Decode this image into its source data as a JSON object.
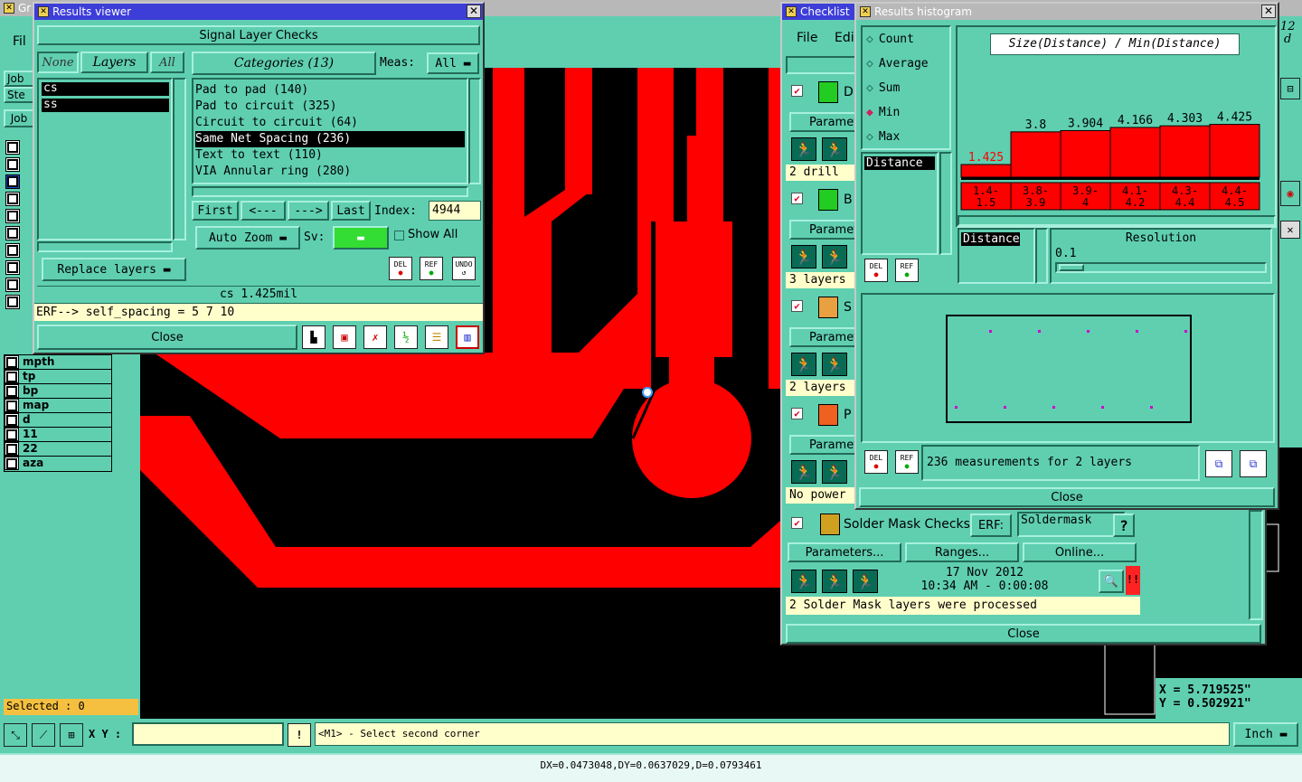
{
  "results_viewer": {
    "title": "Results viewer",
    "header": "Signal Layer Checks",
    "none_btn": "None",
    "layers_btn": "Layers",
    "all_btn": "All",
    "categories_btn": "Categories (13)",
    "meas_label": "Meas:",
    "meas_value": "All",
    "layers": [
      "cs",
      "ss"
    ],
    "categories": [
      "Pad to pad (140)",
      "Pad to circuit (325)",
      "Circuit to circuit (64)",
      "Same Net Spacing (236)",
      "Text to text (110)",
      "VIA Annular ring (280)"
    ],
    "selected_category": 3,
    "nav": {
      "first": "First",
      "prev": "<---",
      "next": "--->",
      "last": "Last",
      "index_label": "Index:",
      "index_value": "4944"
    },
    "auto_zoom": "Auto Zoom",
    "sv_label": "Sv:",
    "show_all": "Show All",
    "replace_layers": "Replace layers",
    "del": "DEL",
    "ref": "REF",
    "undo": "UNDO",
    "status": "cs 1.425mil",
    "erf_line": "ERF--> self_spacing = 5 7 10",
    "close": "Close"
  },
  "main": {
    "menu_file": "Fil",
    "left_rows": [
      "Job",
      "Ste",
      "Job"
    ],
    "layer_names": [
      "mpth",
      "tp",
      "bp",
      "map",
      "d",
      "11",
      "22",
      "aza"
    ],
    "selected": "Selected : 0",
    "xy_label": "X Y :",
    "prompt": "<M1> - Select second corner",
    "units": "Inch",
    "status_bar": "DX=0.0473048,DY=0.0637029,D=0.0793461",
    "coord_x": "X = 5.719525\"",
    "coord_y": "Y = 0.502921\"",
    "corner_text": "12",
    "corner_text2": "d"
  },
  "checklist": {
    "title": "Checklist",
    "menu": [
      "File",
      "Edi"
    ],
    "items": [
      {
        "name": "D",
        "params": "Paramet",
        "status": "2 drill"
      },
      {
        "name": "B",
        "params": "Paramet",
        "status": "3 layers"
      },
      {
        "name": "S",
        "params": "Paramet",
        "status": "2 layers"
      },
      {
        "name": "P",
        "params": "Paramet",
        "status": "No power"
      }
    ],
    "solder": {
      "name": "Solder Mask Checks",
      "erf_label": "ERF:",
      "erf_value": "Soldermask",
      "question": "?",
      "parameters": "Parameters...",
      "ranges": "Ranges...",
      "online": "Online...",
      "date": "17 Nov 2012",
      "time": "10:34 AM - 0:00:08",
      "status": "2 Solder Mask layers were processed",
      "alert": "!!"
    },
    "close": "Close"
  },
  "histogram": {
    "title": "Results histogram",
    "modes": [
      "Count",
      "Average",
      "Sum",
      "Min",
      "Max"
    ],
    "selected_mode": 3,
    "formula": "Size(Distance) / Min(Distance)",
    "list_item": "Distance",
    "resolution_field": "Distance",
    "resolution_label": "Resolution",
    "resolution_value": "0.1",
    "summary": "236 measurements for 2 layers",
    "del": "DEL",
    "ref": "REF",
    "close": "Close",
    "chart_data": {
      "type": "bar",
      "categories": [
        "1.4-\n1.5",
        "3.8-\n3.9",
        "3.9-\n4",
        "4.1-\n4.2",
        "4.3-\n4.4",
        "4.4-\n4.5"
      ],
      "values": [
        1.425,
        3.8,
        3.904,
        4.166,
        4.303,
        4.425
      ],
      "value_labels": [
        "1.425",
        "3.8",
        "3.904",
        "4.166",
        "4.303",
        "4.425"
      ],
      "bar_color": "#ff0000",
      "first_label_color": "#ff0000",
      "ylim": [
        0,
        5
      ]
    }
  },
  "colors": {
    "teal": "#5fcfb0",
    "trace": "#ff0000",
    "title_active": "#3d3dd8"
  }
}
